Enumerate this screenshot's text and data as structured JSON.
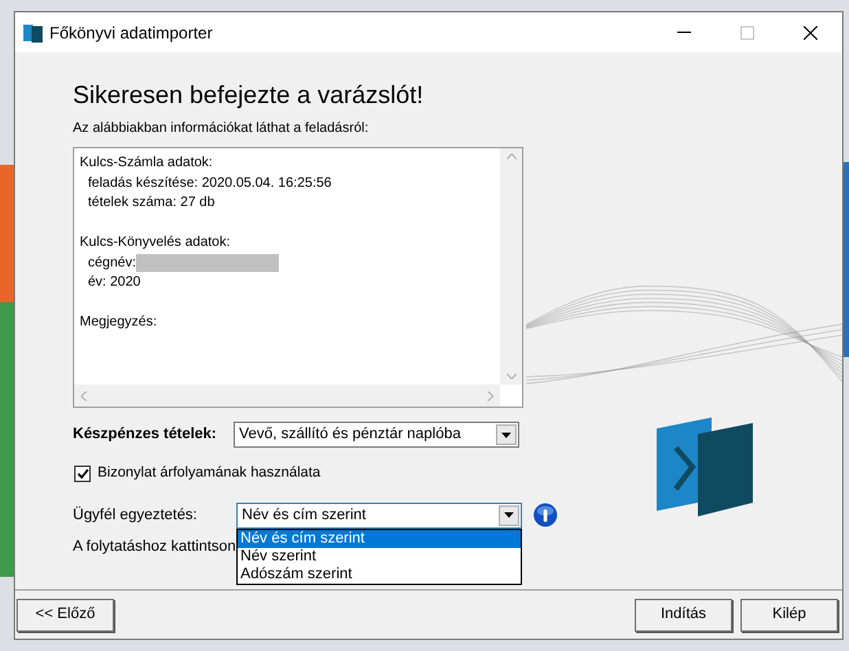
{
  "window": {
    "title": "Főkönyvi adatimporter"
  },
  "heading": "Sikeresen befejezte a varázslót!",
  "subheading": "Az alábbiakban információkat láthat a feladásról:",
  "summary_lines": [
    {
      "kind": "header",
      "text": "Kulcs-Számla adatok:"
    },
    {
      "kind": "item",
      "text": "feladás készítése: 2020.05.04. 16:25:56"
    },
    {
      "kind": "item",
      "text": "tételek száma: 27 db"
    },
    {
      "kind": "blank"
    },
    {
      "kind": "header",
      "text": "Kulcs-Könyvelés adatok:"
    },
    {
      "kind": "redacted",
      "text": "cégnév:"
    },
    {
      "kind": "item",
      "text": "év: 2020"
    },
    {
      "kind": "blank"
    },
    {
      "kind": "header",
      "text": "Megjegyzés:"
    }
  ],
  "cash_items": {
    "label": "Készpénzes tételek:",
    "value": "Vevő, szállító és pénztár naplóba"
  },
  "exchange_rate_checkbox": {
    "label": "Bizonylat árfolyamának használata",
    "checked": true
  },
  "client_matching": {
    "label": "Ügyfél egyeztetés:",
    "value": "Név és cím szerint",
    "expanded": true,
    "options": [
      {
        "label": "Név és cím szerint",
        "selected": true
      },
      {
        "label": "Név szerint",
        "selected": false
      },
      {
        "label": "Adószám szerint",
        "selected": false
      }
    ]
  },
  "continue_hint": "A folytatáshoz kattintson",
  "buttons": {
    "back": "<< Előző",
    "start": "Indítás",
    "exit": "Kilép"
  }
}
